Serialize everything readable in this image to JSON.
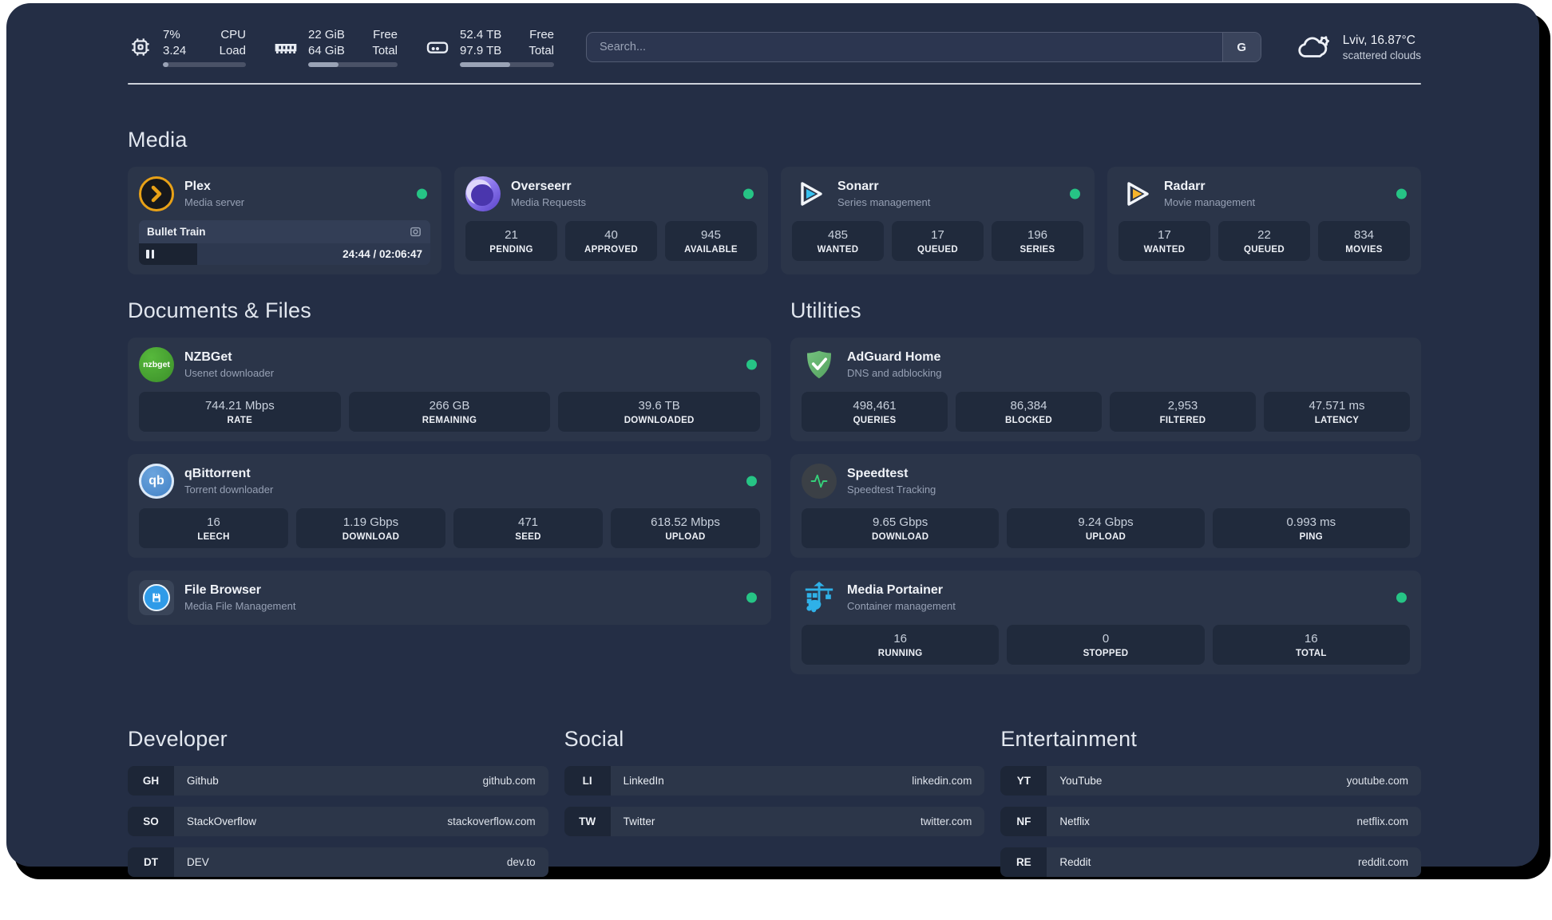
{
  "header": {
    "metrics": [
      {
        "icon": "cpu-icon",
        "values": [
          "7%",
          "3.24"
        ],
        "labels": [
          "CPU",
          "Load"
        ],
        "progress": 7
      },
      {
        "icon": "ram-icon",
        "values": [
          "22 GiB",
          "64 GiB"
        ],
        "labels": [
          "Free",
          "Total"
        ],
        "progress": 34
      },
      {
        "icon": "disk-icon",
        "values": [
          "52.4 TB",
          "97.9 TB"
        ],
        "labels": [
          "Free",
          "Total"
        ],
        "progress": 53
      }
    ],
    "search": {
      "placeholder": "Search...",
      "provider_button": "G"
    },
    "weather": {
      "location": "Lviv, 16.87°C",
      "condition": "scattered clouds"
    }
  },
  "media": {
    "title": "Media",
    "plex": {
      "name": "Plex",
      "subtitle": "Media server",
      "status": "online",
      "now_playing": {
        "title": "Bullet Train",
        "time": "24:44 / 02:06:47",
        "progress_percent": 20
      }
    },
    "overseerr": {
      "name": "Overseerr",
      "subtitle": "Media Requests",
      "status": "online",
      "stats": [
        {
          "value": "21",
          "label": "PENDING"
        },
        {
          "value": "40",
          "label": "APPROVED"
        },
        {
          "value": "945",
          "label": "AVAILABLE"
        }
      ]
    },
    "sonarr": {
      "name": "Sonarr",
      "subtitle": "Series management",
      "status": "online",
      "stats": [
        {
          "value": "485",
          "label": "WANTED"
        },
        {
          "value": "17",
          "label": "QUEUED"
        },
        {
          "value": "196",
          "label": "SERIES"
        }
      ]
    },
    "radarr": {
      "name": "Radarr",
      "subtitle": "Movie management",
      "status": "online",
      "stats": [
        {
          "value": "17",
          "label": "WANTED"
        },
        {
          "value": "22",
          "label": "QUEUED"
        },
        {
          "value": "834",
          "label": "MOVIES"
        }
      ]
    }
  },
  "documents": {
    "title": "Documents & Files",
    "nzbget": {
      "name": "NZBGet",
      "subtitle": "Usenet downloader",
      "status": "online",
      "icon_text": "nzbget",
      "stats": [
        {
          "value": "744.21 Mbps",
          "label": "RATE"
        },
        {
          "value": "266 GB",
          "label": "REMAINING"
        },
        {
          "value": "39.6 TB",
          "label": "DOWNLOADED"
        }
      ]
    },
    "qbittorrent": {
      "name": "qBittorrent",
      "subtitle": "Torrent downloader",
      "status": "online",
      "icon_text": "qb",
      "stats": [
        {
          "value": "16",
          "label": "LEECH"
        },
        {
          "value": "1.19 Gbps",
          "label": "DOWNLOAD"
        },
        {
          "value": "471",
          "label": "SEED"
        },
        {
          "value": "618.52 Mbps",
          "label": "UPLOAD"
        }
      ]
    },
    "filebrowser": {
      "name": "File Browser",
      "subtitle": "Media File Management",
      "status": "online"
    }
  },
  "utilities": {
    "title": "Utilities",
    "adguard": {
      "name": "AdGuard Home",
      "subtitle": "DNS and adblocking",
      "stats": [
        {
          "value": "498,461",
          "label": "QUERIES"
        },
        {
          "value": "86,384",
          "label": "BLOCKED"
        },
        {
          "value": "2,953",
          "label": "FILTERED"
        },
        {
          "value": "47.571 ms",
          "label": "LATENCY"
        }
      ]
    },
    "speedtest": {
      "name": "Speedtest",
      "subtitle": "Speedtest Tracking",
      "stats": [
        {
          "value": "9.65 Gbps",
          "label": "DOWNLOAD"
        },
        {
          "value": "9.24 Gbps",
          "label": "UPLOAD"
        },
        {
          "value": "0.993 ms",
          "label": "PING"
        }
      ]
    },
    "portainer": {
      "name": "Media Portainer",
      "subtitle": "Container management",
      "status": "online",
      "stats": [
        {
          "value": "16",
          "label": "RUNNING"
        },
        {
          "value": "0",
          "label": "STOPPED"
        },
        {
          "value": "16",
          "label": "TOTAL"
        }
      ]
    }
  },
  "bookmarks": [
    {
      "title": "Developer",
      "links": [
        {
          "abbr": "GH",
          "name": "Github",
          "url": "github.com"
        },
        {
          "abbr": "SO",
          "name": "StackOverflow",
          "url": "stackoverflow.com"
        },
        {
          "abbr": "DT",
          "name": "DEV",
          "url": "dev.to"
        }
      ]
    },
    {
      "title": "Social",
      "links": [
        {
          "abbr": "LI",
          "name": "LinkedIn",
          "url": "linkedin.com"
        },
        {
          "abbr": "TW",
          "name": "Twitter",
          "url": "twitter.com"
        }
      ]
    },
    {
      "title": "Entertainment",
      "links": [
        {
          "abbr": "YT",
          "name": "YouTube",
          "url": "youtube.com"
        },
        {
          "abbr": "NF",
          "name": "Netflix",
          "url": "netflix.com"
        },
        {
          "abbr": "RE",
          "name": "Reddit",
          "url": "reddit.com"
        }
      ]
    }
  ],
  "colors": {
    "status_online": "#26c485",
    "panel_bg": "#242e45",
    "card_bg": "#2b3549",
    "tile_bg": "#202a3c",
    "plex_accent": "#e8a117",
    "sonarr_accent": "#38c1ef",
    "radarr_accent": "#f7b52c",
    "adguard_green": "#63b36e",
    "portainer_blue": "#2fb1e8",
    "speedtest_pulse": "#35d07a"
  }
}
